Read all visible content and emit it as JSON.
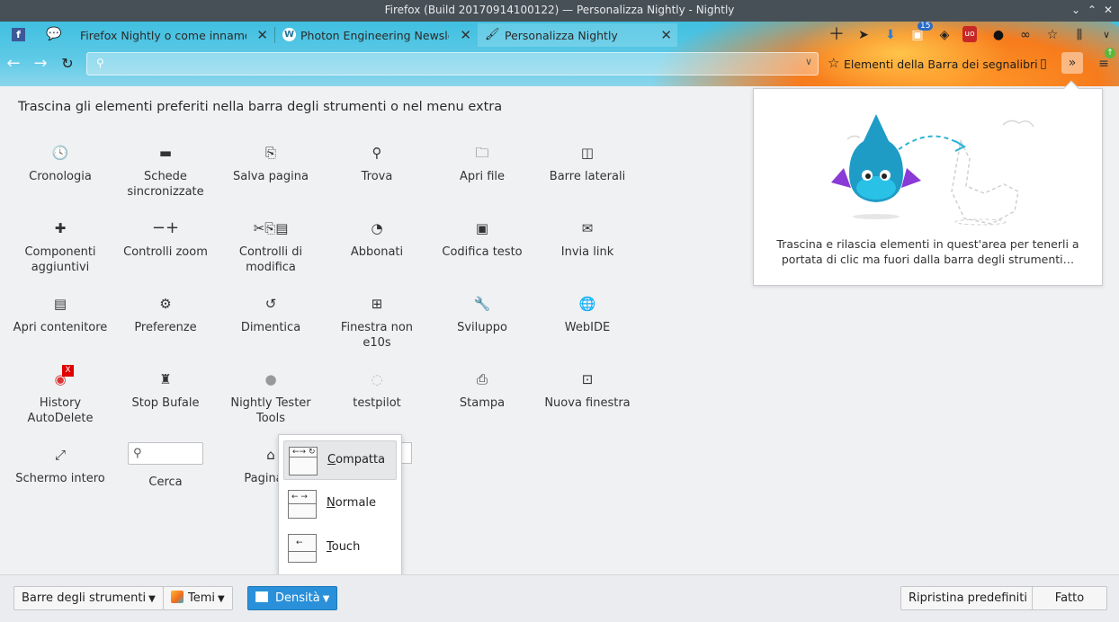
{
  "window": {
    "title": "Firefox (Build 20170914100122) — Personalizza Nightly - Nightly"
  },
  "tabs": [
    {
      "label": "Firefox Nightly o come innamor",
      "icon": "speech-bubble-icon"
    },
    {
      "label": "Photon Engineering Newsle",
      "icon": "wordpress-icon"
    },
    {
      "label": "Personalizza Nightly",
      "icon": "paintbrush-icon"
    }
  ],
  "toolbar": {
    "bookmarks_label": "Elementi della Barra dei segnalibri",
    "badge_count": "15"
  },
  "palette": {
    "instructions": "Trascina gli elementi preferiti nella barra degli strumenti o nel menu extra",
    "items": [
      {
        "label": "Cronologia",
        "icon": "clock-icon"
      },
      {
        "label": "Schede sincronizzate",
        "icon": "laptop-icon"
      },
      {
        "label": "Salva pagina",
        "icon": "save-page-icon"
      },
      {
        "label": "Trova",
        "icon": "search-icon"
      },
      {
        "label": "Apri file",
        "icon": "open-file-icon"
      },
      {
        "label": "Barre laterali",
        "icon": "sidebar-icon"
      },
      {
        "label": "Componenti aggiuntivi",
        "icon": "puzzle-icon"
      },
      {
        "label": "Controlli zoom",
        "icon": "zoom-icon"
      },
      {
        "label": "Controlli di modifica",
        "icon": "edit-controls-icon"
      },
      {
        "label": "Abbonati",
        "icon": "rss-icon"
      },
      {
        "label": "Codifica testo",
        "icon": "text-encoding-icon"
      },
      {
        "label": "Invia link",
        "icon": "mail-icon"
      },
      {
        "label": "Apri contenitore",
        "icon": "container-icon"
      },
      {
        "label": "Preferenze",
        "icon": "gear-icon"
      },
      {
        "label": "Dimentica",
        "icon": "forget-icon"
      },
      {
        "label": "Finestra non e10s",
        "icon": "new-window-icon"
      },
      {
        "label": "Sviluppo",
        "icon": "wrench-icon"
      },
      {
        "label": "WebIDE",
        "icon": "webide-icon"
      },
      {
        "label": "History AutoDelete",
        "icon": "history-autodelete-icon"
      },
      {
        "label": "Stop Bufale",
        "icon": "stop-bufale-icon"
      },
      {
        "label": "Nightly Tester Tools",
        "icon": "tester-tools-icon"
      },
      {
        "label": "testpilot",
        "icon": "testpilot-icon"
      },
      {
        "label": "Stampa",
        "icon": "printer-icon"
      },
      {
        "label": "Nuova finestra",
        "icon": "window-icon"
      },
      {
        "label": "Schermo intero",
        "icon": "fullscreen-icon"
      },
      {
        "label": "Cerca",
        "icon": "search-box"
      },
      {
        "label": "Pagina in",
        "icon": "home-icon"
      }
    ]
  },
  "overflow_panel": {
    "message": "Trascina e rilascia elementi in quest'area per tenerli a portata di clic ma fuori dalla barra degli strumenti…"
  },
  "density_menu": {
    "options": [
      {
        "label": "Compatta",
        "accesskey": "C",
        "rest": "ompatta",
        "selected": true
      },
      {
        "label": "Normale",
        "accesskey": "N",
        "rest": "ormale",
        "selected": false
      },
      {
        "label": "Touch",
        "accesskey": "T",
        "rest": "ouch",
        "selected": false
      }
    ]
  },
  "bottom_bar": {
    "toolbars_label": "Barre degli strumenti",
    "themes_label": "Temi",
    "density_label": "Densità",
    "restore_label": "Ripristina predefiniti",
    "done_label": "Fatto"
  },
  "colors": {
    "header_blue": "#40bfe0",
    "accent": "#2a90d9",
    "badge_red": "#e00000"
  }
}
